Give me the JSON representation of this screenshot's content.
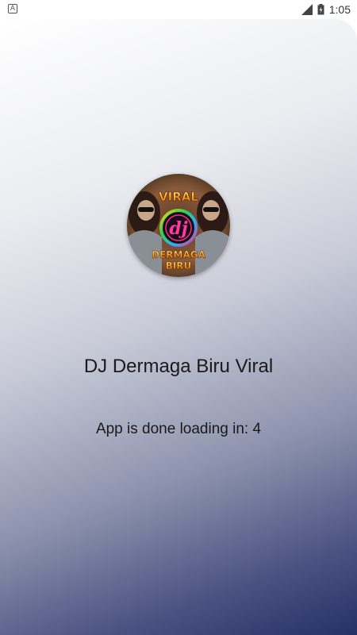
{
  "status_bar": {
    "notification_icon": "a-icon",
    "time": "1:05"
  },
  "splash": {
    "logo": {
      "text_top": "VIRAL",
      "text_center": "dj",
      "text_bottom_1": "DERMAGA",
      "text_bottom_2": "BIRU"
    },
    "title": "DJ Dermaga Biru Viral",
    "loading_text": "App is done loading in: 4"
  },
  "colors": {
    "gradient_top": "#ffffff",
    "gradient_bottom": "#273064"
  }
}
